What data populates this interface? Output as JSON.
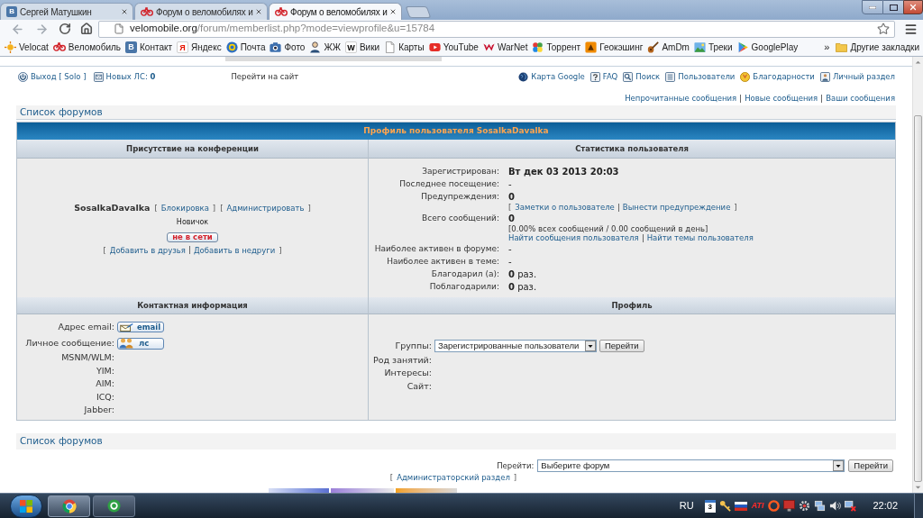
{
  "browser": {
    "tabs": [
      {
        "title": "Сергей Матушкин",
        "icon_text": "В",
        "selected": false
      },
      {
        "title": "Форум о веломобилях и",
        "selected": false
      },
      {
        "title": "Форум о веломобилях и",
        "selected": true
      }
    ],
    "address": {
      "host": "velomobile.org",
      "path": "/forum/memberlist.php?mode=viewprofile&u=15784"
    },
    "bookmarks": [
      {
        "label": "Velocat"
      },
      {
        "label": "Веломобиль"
      },
      {
        "label": "Контакт",
        "icon_text": "В"
      },
      {
        "label": "Яндекс",
        "icon_text": "Я"
      },
      {
        "label": "Почта"
      },
      {
        "label": "Фото"
      },
      {
        "label": "ЖЖ"
      },
      {
        "label": "Вики",
        "icon_text": "W"
      },
      {
        "label": "Карты"
      },
      {
        "label": "YouTube"
      },
      {
        "label": "WarNet"
      },
      {
        "label": "Торрент"
      },
      {
        "label": "Геокэшинг"
      },
      {
        "label": "AmDm"
      },
      {
        "label": "Треки"
      },
      {
        "label": "GooglePlay"
      }
    ],
    "bookmarks_more": "»",
    "other_bookmarks": "Другие закладки"
  },
  "page": {
    "logout": "Выход [ Solo ]",
    "new_messages": "Новых ЛС: **0**",
    "site_link": "Перейти на сайт",
    "nav_right": [
      "Карта Google",
      "FAQ",
      "Поиск",
      "Пользователи",
      "Благодарности",
      "Личный раздел"
    ],
    "message_links": {
      "links": [
        "Непрочитанные сообщения",
        "Новые сообщения",
        "Ваши сообщения"
      ]
    },
    "breadcrumb": "Список форумов",
    "profile": {
      "title": "Профиль пользователя SosalkaDavalka",
      "presence": {
        "heading": "Присутствие на конференции",
        "username": "SosalkaDavalka",
        "mod_links": [
          {
            "open": "[",
            "links": [
              "Блокировка"
            ],
            "close": "]"
          },
          {
            "open": "[",
            "links": [
              "Администрировать"
            ],
            "close": "]"
          }
        ],
        "rank": "Новичок",
        "status": {
          "label": "не в сети",
          "online": false
        },
        "friend_links": {
          "open": "[",
          "links": [
            "Добавить в друзья",
            "Добавить в недруги"
          ],
          "close": "]"
        }
      },
      "stats": {
        "heading": "Статистика пользователя",
        "rows": [
          {
            "label": "Зарегистрирован:",
            "value": "Вт дек 03 2013 20:03",
            "bold": true
          },
          {
            "label": "Последнее посещение:",
            "value": "-",
            "bold": false
          },
          {
            "label": "Предупреждения:",
            "value": "0",
            "bold": true,
            "links": {
              "open": "[",
              "links": [
                "Заметки о пользователе",
                "Вынести предупреждение"
              ],
              "close": "]"
            }
          },
          {
            "label": "Всего сообщений:",
            "value": "0",
            "bold": true,
            "note": "[0.00% всех сообщений / 0.00 сообщений в день]",
            "links": {
              "links": [
                "Найти сообщения пользователя",
                "Найти темы пользователя"
              ]
            }
          },
          {
            "label": "Наиболее активен в форуме:",
            "value": "-",
            "bold": false
          },
          {
            "label": "Наиболее активен в теме:",
            "value": "-",
            "bold": false
          },
          {
            "label": "Благодарил (а):",
            "value": "**0** раз.",
            "bold": false
          },
          {
            "label": "Поблагодарили:",
            "value": "**0** раз.",
            "bold": false
          }
        ]
      },
      "contact": {
        "heading": "Контактная информация",
        "rows": [
          {
            "label": "Адрес email:",
            "kind": "email",
            "button": "email"
          },
          {
            "label": "Личное сообщение:",
            "kind": "message",
            "button": "лс"
          },
          {
            "label": "MSNM/WLM:",
            "kind": "empty"
          },
          {
            "label": "YIM:",
            "kind": "empty"
          },
          {
            "label": "AIM:",
            "kind": "empty"
          },
          {
            "label": "ICQ:",
            "kind": "empty"
          },
          {
            "label": "Jabber:",
            "kind": "empty"
          }
        ]
      },
      "details": {
        "heading": "Профиль",
        "rows": [
          {
            "label": "Группы:",
            "kind": "select",
            "value": "Зарегистрированные пользователи",
            "button": "Перейти"
          },
          {
            "label": "Род занятий:",
            "kind": "empty"
          },
          {
            "label": "Интересы:",
            "kind": "empty"
          },
          {
            "label": "Сайт:",
            "kind": "empty"
          }
        ]
      }
    },
    "footer_breadcrumb": "Список форумов",
    "jump": {
      "label": "Перейти:",
      "value": "Выберите форум",
      "button": "Перейти"
    },
    "admin_link": {
      "open": "[",
      "links": [
        "Администраторский раздел"
      ],
      "close": "]"
    }
  },
  "taskbar": {
    "language": "RU",
    "calendar_text": "3",
    "vendor_text": "ATI",
    "time": "22:02"
  }
}
